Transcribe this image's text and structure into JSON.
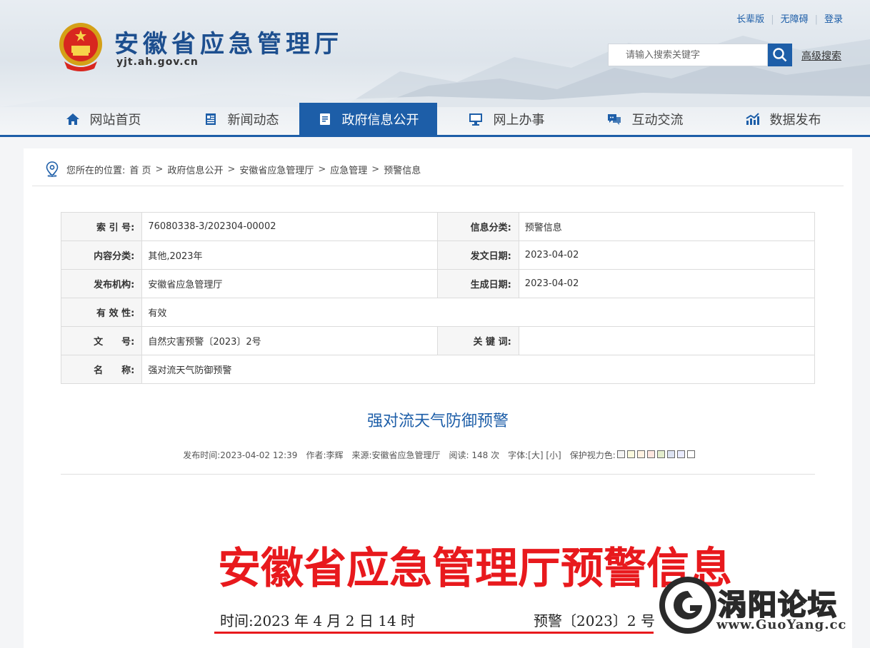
{
  "header": {
    "site_name": "安徽省应急管理厅",
    "domain": "yjt.ah.gov.cn",
    "top_links": [
      "长辈版",
      "无障碍",
      "登录"
    ],
    "search_placeholder": "请输入搜索关键字",
    "advanced_search": "高级搜索"
  },
  "nav": {
    "items": [
      {
        "label": "网站首页",
        "icon": "home-icon"
      },
      {
        "label": "新闻动态",
        "icon": "news-icon"
      },
      {
        "label": "政府信息公开",
        "icon": "document-icon",
        "active": true
      },
      {
        "label": "网上办事",
        "icon": "monitor-icon"
      },
      {
        "label": "互动交流",
        "icon": "chat-icon"
      },
      {
        "label": "数据发布",
        "icon": "chart-icon"
      }
    ],
    "accent_color": "#1d5ea8"
  },
  "breadcrumb": {
    "prefix": "您所在的位置:",
    "items": [
      "首 页",
      "政府信息公开",
      "安徽省应急管理厅",
      "应急管理",
      "预警信息"
    ]
  },
  "meta": {
    "index_no_label": "索 引 号:",
    "index_no": "76080338-3/202304-00002",
    "category_label": "信息分类:",
    "category": "预警信息",
    "content_type_label": "内容分类:",
    "content_type": "其他,2023年",
    "issue_date_label": "发文日期:",
    "issue_date": "2023-04-02",
    "publisher_label": "发布机构:",
    "publisher": "安徽省应急管理厅",
    "created_date_label": "生成日期:",
    "created_date": "2023-04-02",
    "validity_label": "有 效 性:",
    "validity": "有效",
    "doc_no_label": "文　　号:",
    "doc_no": "自然灾害预警〔2023〕2号",
    "keywords_label": "关 键 词:",
    "keywords": "",
    "name_label": "名　　称:",
    "name": "强对流天气防御预警"
  },
  "article": {
    "title": "强对流天气防御预警",
    "publish_time": "发布时间:2023-04-02 12:39",
    "author": "作者:李辉",
    "source": "来源:安徽省应急管理厅",
    "reads": "阅读: 148 次",
    "font_size": "字体:[大] [小]",
    "eye_care": "保护视力色:"
  },
  "document": {
    "header": "安徽省应急管理厅预警信息",
    "time": "时间:2023 年 4 月 2 日 14 时",
    "number": "预警〔2023〕2 号"
  },
  "watermark": {
    "text": "涡阳论坛",
    "url": "www.GuoYang.cc"
  }
}
